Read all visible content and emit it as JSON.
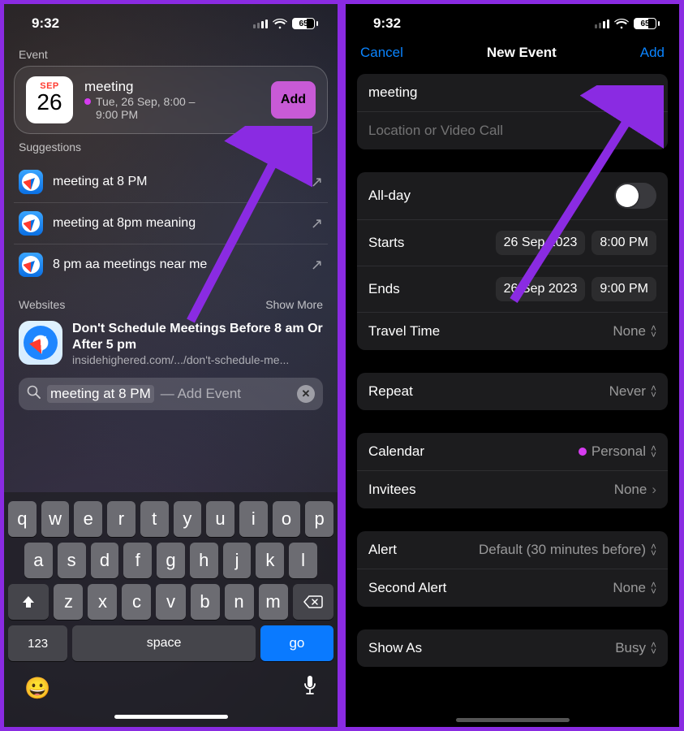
{
  "status": {
    "time": "9:32",
    "battery": "65"
  },
  "phone1": {
    "eventHeader": "Event",
    "eventCard": {
      "month": "SEP",
      "day": "26",
      "title": "meeting",
      "line1": "Tue, 26 Sep, 8:00 –",
      "line2": "9:00 PM",
      "addLabel": "Add"
    },
    "suggestionsHeader": "Suggestions",
    "suggestions": [
      {
        "text": "meeting at 8 PM"
      },
      {
        "text": "meeting at 8pm meaning"
      },
      {
        "text": "8 pm aa meetings near me"
      }
    ],
    "websitesHeader": "Websites",
    "showMore": "Show More",
    "website": {
      "title": "Don't Schedule Meetings Before 8 am Or After 5 pm",
      "url": "insidehighered.com/.../don't-schedule-me..."
    },
    "search": {
      "typed": "meeting at 8 PM",
      "suffix": " — Add Event"
    },
    "keyboard": {
      "row1": [
        "q",
        "w",
        "e",
        "r",
        "t",
        "y",
        "u",
        "i",
        "o",
        "p"
      ],
      "row2": [
        "a",
        "s",
        "d",
        "f",
        "g",
        "h",
        "j",
        "k",
        "l"
      ],
      "row3": [
        "z",
        "x",
        "c",
        "v",
        "b",
        "n",
        "m"
      ],
      "numLabel": "123",
      "spaceLabel": "space",
      "goLabel": "go"
    }
  },
  "phone2": {
    "nav": {
      "cancel": "Cancel",
      "title": "New Event",
      "add": "Add"
    },
    "titleField": "meeting",
    "locationPlaceholder": "Location or Video Call",
    "allDayLabel": "All-day",
    "starts": {
      "label": "Starts",
      "date": "26 Sep 2023",
      "time": "8:00 PM"
    },
    "ends": {
      "label": "Ends",
      "date": "26 Sep 2023",
      "time": "9:00 PM"
    },
    "travelTime": {
      "label": "Travel Time",
      "value": "None"
    },
    "repeat": {
      "label": "Repeat",
      "value": "Never"
    },
    "calendar": {
      "label": "Calendar",
      "value": "Personal"
    },
    "invitees": {
      "label": "Invitees",
      "value": "None"
    },
    "alert": {
      "label": "Alert",
      "value": "Default (30 minutes before)"
    },
    "secondAlert": {
      "label": "Second Alert",
      "value": "None"
    },
    "showAs": {
      "label": "Show As",
      "value": "Busy"
    }
  }
}
